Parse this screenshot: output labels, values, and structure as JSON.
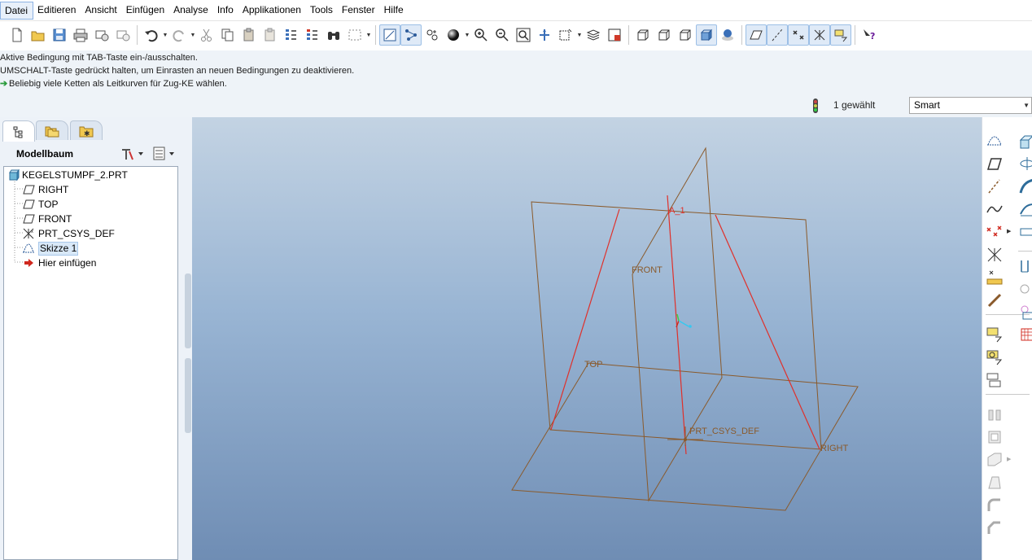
{
  "menu": {
    "items": [
      "Datei",
      "Editieren",
      "Ansicht",
      "Einfügen",
      "Analyse",
      "Info",
      "Applikationen",
      "Tools",
      "Fenster",
      "Hilfe"
    ],
    "active_index": 0
  },
  "messages": [
    "Aktive Bedingung mit TAB-Taste ein-/ausschalten.",
    "UMSCHALT-Taste gedrückt halten, um Einrasten an neuen Bedingungen zu deaktivieren.",
    "Beliebig viele Ketten als Leitkurven für Zug-KE wählen."
  ],
  "status": {
    "selection_count": "1 gewählt",
    "filter_value": "Smart"
  },
  "model_tree": {
    "title": "Modellbaum",
    "items": [
      {
        "label": "KEGELSTUMPF_2.PRT",
        "icon": "part-icon"
      },
      {
        "label": "RIGHT",
        "icon": "datum-plane-icon"
      },
      {
        "label": "TOP",
        "icon": "datum-plane-icon"
      },
      {
        "label": "FRONT",
        "icon": "datum-plane-icon"
      },
      {
        "label": "PRT_CSYS_DEF",
        "icon": "csys-icon"
      },
      {
        "label": "Skizze 1",
        "icon": "sketch-icon"
      },
      {
        "label": "Hier einfügen",
        "icon": "insert-arrow-icon"
      }
    ],
    "selected_index": 5
  },
  "graphics": {
    "labels": {
      "axis": "A_1",
      "front": "FRONT",
      "top": "TOP",
      "csys": "PRT_CSYS_DEF",
      "right": "RIGHT"
    },
    "colors": {
      "datum": "#8a5a2b",
      "sketch": "#e0302a",
      "background_top": "#c3d3e3",
      "background_bottom": "#6f8db4"
    }
  }
}
